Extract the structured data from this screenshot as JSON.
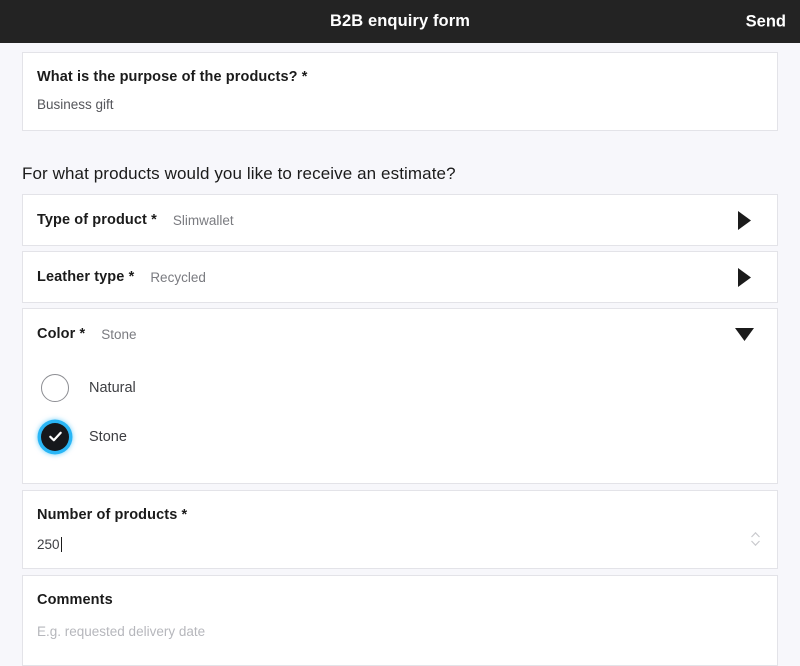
{
  "appbar": {
    "title": "B2B enquiry form",
    "send_label": "Send"
  },
  "purpose": {
    "label": "What is the purpose of the products?",
    "required_mark": "*",
    "value": "Business gift"
  },
  "section": {
    "heading": "For what products would you like to receive an estimate?"
  },
  "accordion": [
    {
      "label": "Type of product",
      "required_mark": "*",
      "value": "Slimwallet",
      "expanded": false,
      "caret_icon": "chevron-right-icon"
    },
    {
      "label": "Leather type",
      "required_mark": "*",
      "value": "Recycled",
      "expanded": false,
      "caret_icon": "chevron-right-icon"
    },
    {
      "label": "Color",
      "required_mark": "*",
      "value": "Stone",
      "expanded": true,
      "caret_icon": "chevron-down-icon"
    }
  ],
  "color_options": [
    {
      "label": "Natural",
      "selected": false
    },
    {
      "label": "Stone",
      "selected": true
    }
  ],
  "number_of_products": {
    "label": "Number of products",
    "required_mark": "*",
    "value": "250",
    "spinner_icon": "stepper-up-down-icon"
  },
  "comments": {
    "label": "Comments",
    "placeholder": "E.g. requested delivery date",
    "value": ""
  },
  "colors": {
    "appbar_bg": "#232323",
    "page_bg": "#f7f7fb",
    "card_bg": "#ffffff",
    "card_border": "#e3e3e8",
    "focus_ring": "#29b6f6",
    "radio_checked_fill": "#16181c",
    "label_text": "#1b1b1b",
    "muted_text": "#7a7b80",
    "placeholder_text": "#b6b7bc"
  }
}
